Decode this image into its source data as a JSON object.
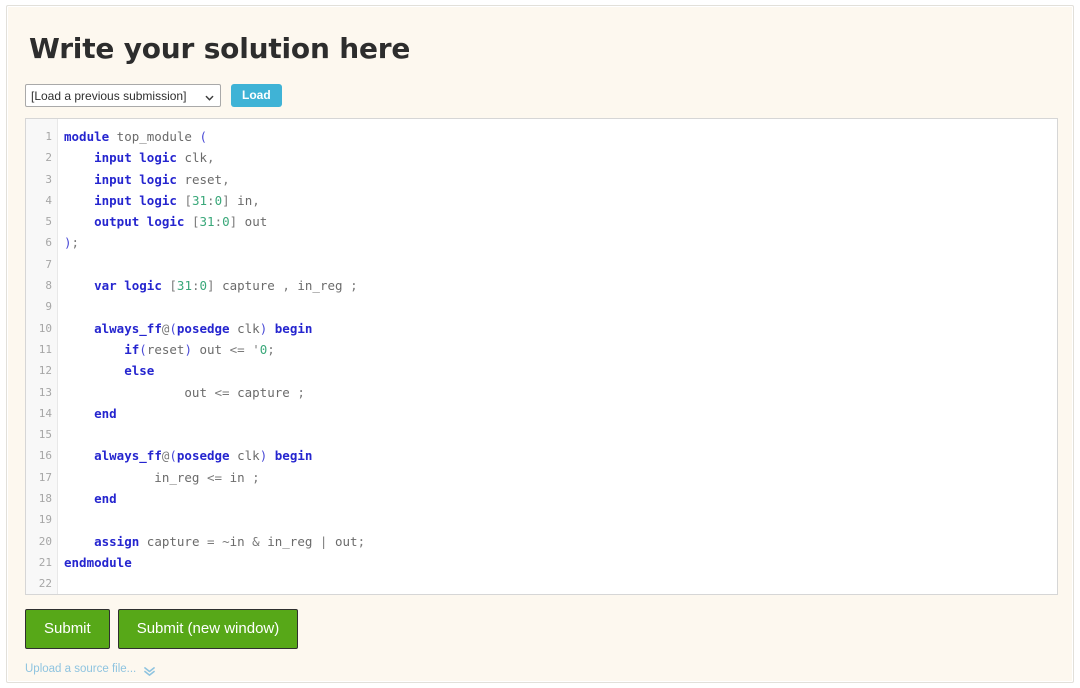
{
  "panel": {
    "title": "Write your solution here"
  },
  "load_row": {
    "select": {
      "selected_value": "[Load a previous submission]",
      "caret_icon": "chevron-down-icon"
    },
    "load_button_label": "Load"
  },
  "editor": {
    "line_numbers": [
      "1",
      "2",
      "3",
      "4",
      "5",
      "6",
      "7",
      "8",
      "9",
      "10",
      "11",
      "12",
      "13",
      "14",
      "15",
      "16",
      "17",
      "18",
      "19",
      "20",
      "21",
      "22"
    ],
    "language": "systemverilog",
    "code_lines": [
      "module top_module (",
      "    input logic clk,",
      "    input logic reset,",
      "    input logic [31:0] in,",
      "    output logic [31:0] out",
      ");",
      "",
      "    var logic [31:0] capture , in_reg ;",
      "",
      "    always_ff@(posedge clk) begin",
      "        if(reset) out <= '0;",
      "        else",
      "                out <= capture ;",
      "    end",
      "",
      "    always_ff@(posedge clk) begin",
      "            in_reg <= in ;",
      "    end",
      "",
      "    assign capture = ~in & in_reg | out;",
      "endmodule",
      ""
    ]
  },
  "actions": {
    "submit_label": "Submit",
    "submit_new_window_label": "Submit (new window)"
  },
  "upload": {
    "link_label": "Upload a source file...",
    "expand_icon": "double-chevron-down-icon"
  },
  "colors": {
    "page_background": "#fdf8ef",
    "editor_background": "#ffffff",
    "gutter_background": "#f8f8f8",
    "keyword": "#2525cf",
    "number": "#3aa87a",
    "plain_text": "#6b6b6b",
    "load_button": "#3fb3d6",
    "submit_button": "#57a818",
    "link": "#8fc4e0",
    "heading": "#2d2d2d"
  }
}
